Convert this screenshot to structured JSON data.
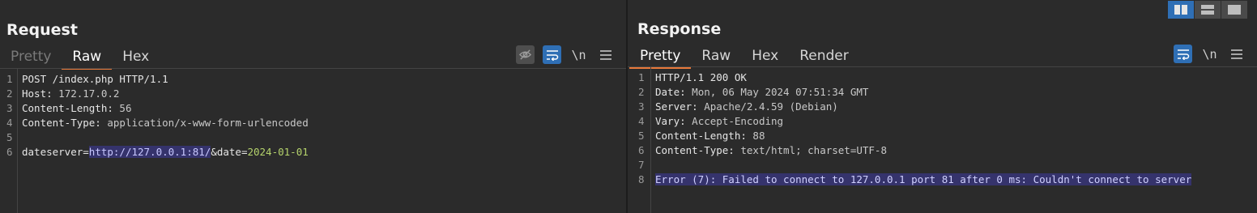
{
  "request": {
    "title": "Request",
    "tabs": [
      {
        "label": "Pretty",
        "state": "dim"
      },
      {
        "label": "Raw",
        "state": "active"
      },
      {
        "label": "Hex",
        "state": "normal"
      }
    ],
    "tools": {
      "hide_icon": "eye-off-icon",
      "wrap_icon": "wrap-icon",
      "newline_label": "\\n",
      "menu_icon": "hamburger-menu-icon"
    },
    "lines": [
      {
        "n": "1",
        "text": "POST /index.php HTTP/1.1"
      },
      {
        "n": "2",
        "key": "Host:",
        "value": " 172.17.0.2"
      },
      {
        "n": "3",
        "key": "Content-Length:",
        "value": " 56"
      },
      {
        "n": "4",
        "key": "Content-Type:",
        "value": " application/x-www-form-urlencoded"
      },
      {
        "n": "5",
        "text": ""
      },
      {
        "n": "6",
        "p1": "dateserver",
        "eq1": "=",
        "v1": "http://127.0.0.1:81/",
        "p2": "&date",
        "eq2": "=",
        "v2": "2024-01-01"
      }
    ]
  },
  "response": {
    "title": "Response",
    "tabs": [
      {
        "label": "Pretty",
        "state": "active"
      },
      {
        "label": "Raw",
        "state": "normal"
      },
      {
        "label": "Hex",
        "state": "normal"
      },
      {
        "label": "Render",
        "state": "normal"
      }
    ],
    "tools": {
      "wrap_icon": "wrap-icon",
      "newline_label": "\\n",
      "menu_icon": "hamburger-menu-icon"
    },
    "lines": [
      {
        "n": "1",
        "text": "HTTP/1.1 200 OK"
      },
      {
        "n": "2",
        "key": "Date:",
        "value": " Mon, 06 May 2024 07:51:34 GMT"
      },
      {
        "n": "3",
        "key": "Server:",
        "value": " Apache/2.4.59 (Debian)"
      },
      {
        "n": "4",
        "key": "Vary:",
        "value": " Accept-Encoding"
      },
      {
        "n": "5",
        "key": "Content-Length:",
        "value": " 88"
      },
      {
        "n": "6",
        "key": "Content-Type:",
        "value": " text/html; charset=UTF-8"
      },
      {
        "n": "7",
        "text": ""
      },
      {
        "n": "8",
        "text": "Error (7): Failed to connect to 127.0.0.1 port 81 after 0 ms: Couldn't connect to server"
      }
    ]
  },
  "layout_buttons": [
    {
      "icon": "side-by-side-layout-icon",
      "active": true
    },
    {
      "icon": "stacked-layout-icon",
      "active": false
    },
    {
      "icon": "single-pane-layout-icon",
      "active": false
    }
  ],
  "colors": {
    "accent_tab": "#e8793a",
    "tool_blue": "#2f6fb5",
    "selection": "#35336c",
    "param_value": "#b5d36c"
  }
}
